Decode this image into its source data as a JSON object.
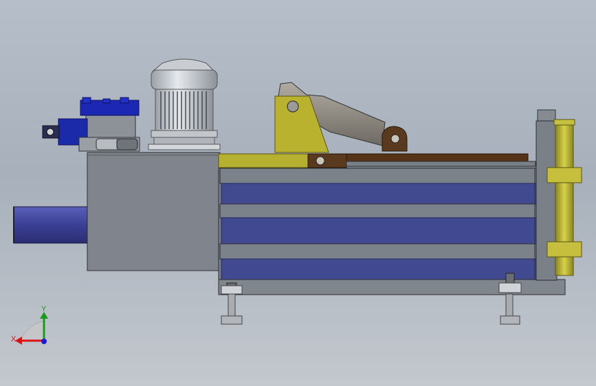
{
  "triad": {
    "x_label": "X",
    "y_label": "Y"
  },
  "palette": {
    "frame_gray": "#777d86",
    "tank_gray": "#7f848c",
    "panel_blue": "#3f4386",
    "olive": "#b9b331",
    "brown": "#5f3a1b",
    "valve_blue": "#1b27b8",
    "axis_red": "#d11",
    "axis_green": "#1a9a1a",
    "axis_blue": "#1a1ad8"
  }
}
